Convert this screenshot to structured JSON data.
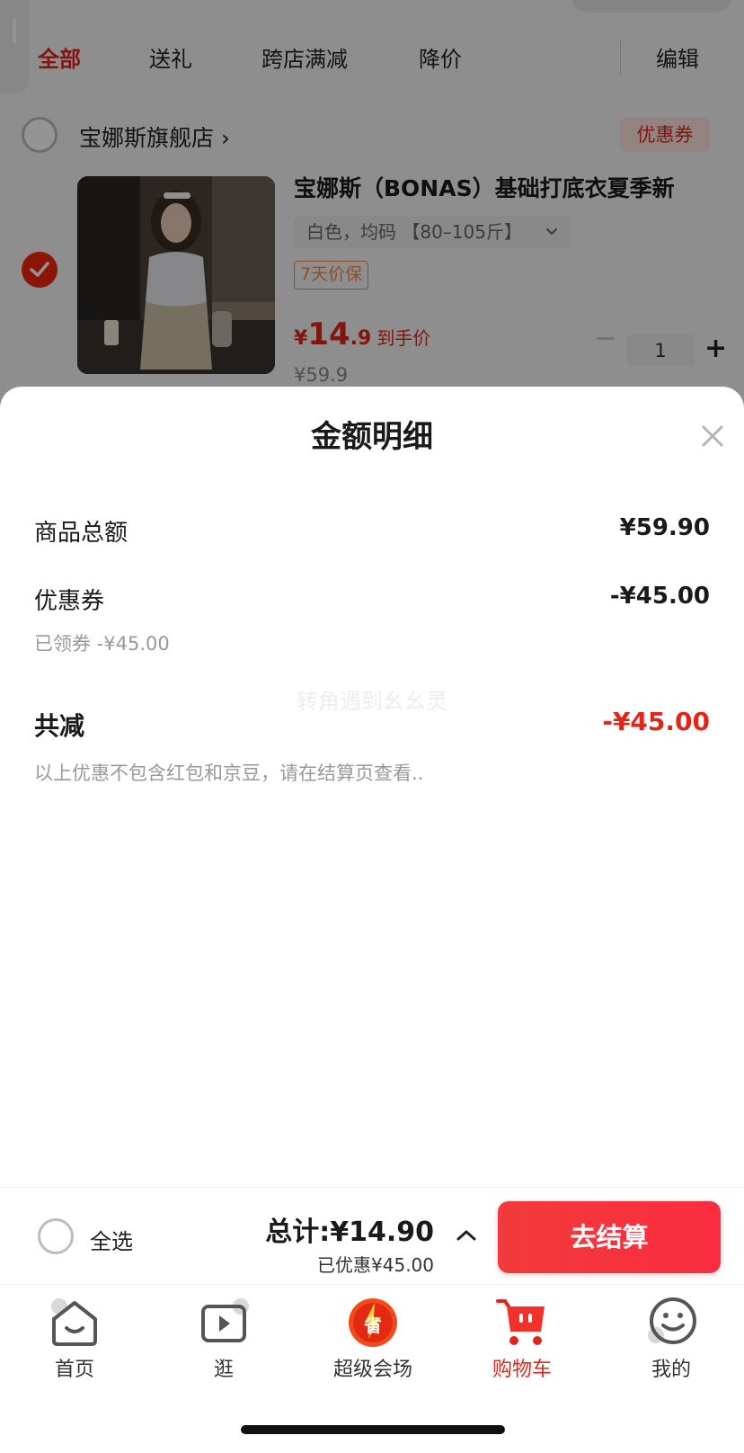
{
  "tabs": {
    "all": "全部",
    "gift": "送礼",
    "cross_store": "跨店满减",
    "price_drop": "降价",
    "edit": "编辑"
  },
  "store": {
    "name": "宝娜斯旗舰店 ›",
    "coupon": "优惠券"
  },
  "product": {
    "title": "宝娜斯（BONAS）基础打底衣夏季新",
    "spec": "白色，均码 【80–105斤】",
    "tag": "7天价保",
    "price_yen": "¥",
    "price_int": "14",
    "price_dec": ".9",
    "price_label": "到手价",
    "original_price": "¥59.9",
    "quantity": "1"
  },
  "sheet": {
    "title": "金额明细",
    "goods_total_label": "商品总额",
    "goods_total_value": "¥59.90",
    "coupon_label": "优惠券",
    "coupon_value": "-¥45.00",
    "coupon_sub": "已领券 -¥45.00",
    "watermark": "转角遇到幺幺灵",
    "total_reduce_label": "共减",
    "total_reduce_value": "-¥45.00",
    "note": "以上优惠不包含红包和京豆，请在结算页查看.."
  },
  "checkout": {
    "select_all": "全选",
    "total": "总计:¥14.90",
    "saved": "已优惠¥45.00",
    "button": "去结算"
  },
  "tabbar": {
    "home": "首页",
    "browse": "逛",
    "super_venue": "超级会场",
    "cart": "购物车",
    "mine": "我的"
  },
  "colors": {
    "accent": "#e1251b",
    "checkout_gradient_start": "#f23b3b",
    "checkout_gradient_end": "#fa2c3f"
  }
}
